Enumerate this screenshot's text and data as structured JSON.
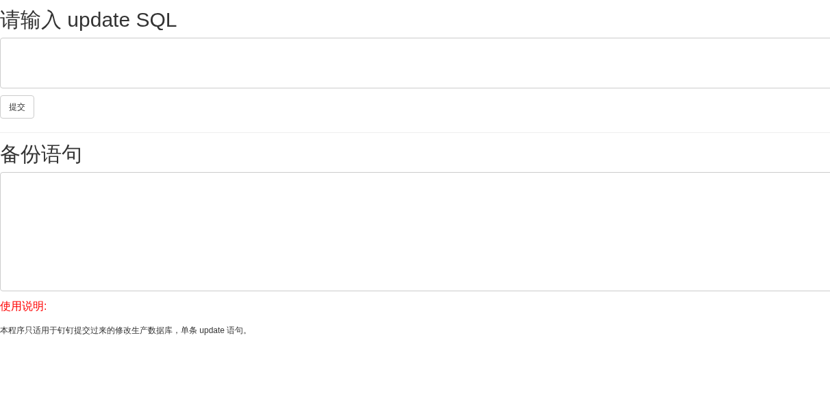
{
  "update_section": {
    "title": "请输入 update SQL",
    "submit_button": "提交"
  },
  "backup_section": {
    "title": "备份语句"
  },
  "usage": {
    "title": "使用说明:",
    "text": "本程序只适用于钉钉提交过来的修改生产数据库，单条 update 语句。"
  }
}
